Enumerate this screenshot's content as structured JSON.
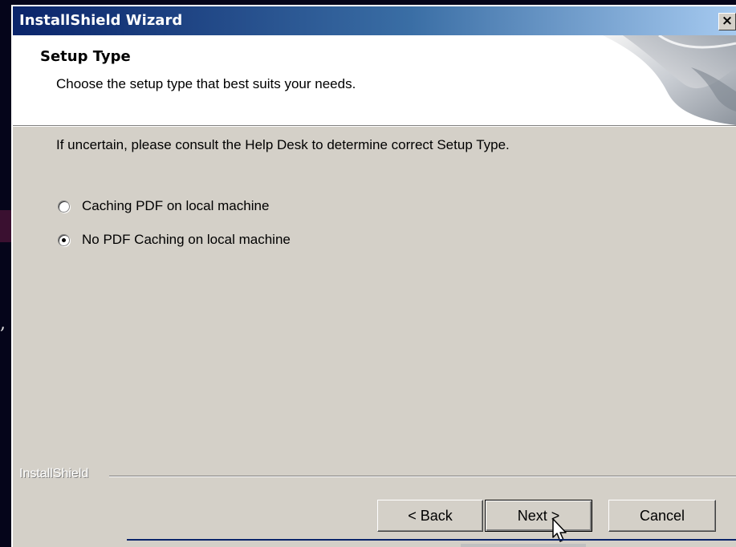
{
  "window": {
    "title": "InstallShield Wizard",
    "close_label": "×"
  },
  "header": {
    "title": "Setup Type",
    "subtitle": "Choose the setup type that best suits your needs."
  },
  "body": {
    "instruction": "If uncertain, please consult the Help Desk to determine correct Setup Type.",
    "options": [
      {
        "label": "Caching PDF on local machine",
        "selected": false
      },
      {
        "label": "No PDF Caching on local machine",
        "selected": true
      }
    ]
  },
  "footer": {
    "brand": "InstallShield",
    "back_label": "< Back",
    "next_label": "Next >",
    "cancel_label": "Cancel"
  },
  "background": {
    "comma": ","
  },
  "icons": {
    "close": "close-icon",
    "header_graphic": "installshield-banner-graphic",
    "cursor": "mouse-pointer-icon"
  }
}
